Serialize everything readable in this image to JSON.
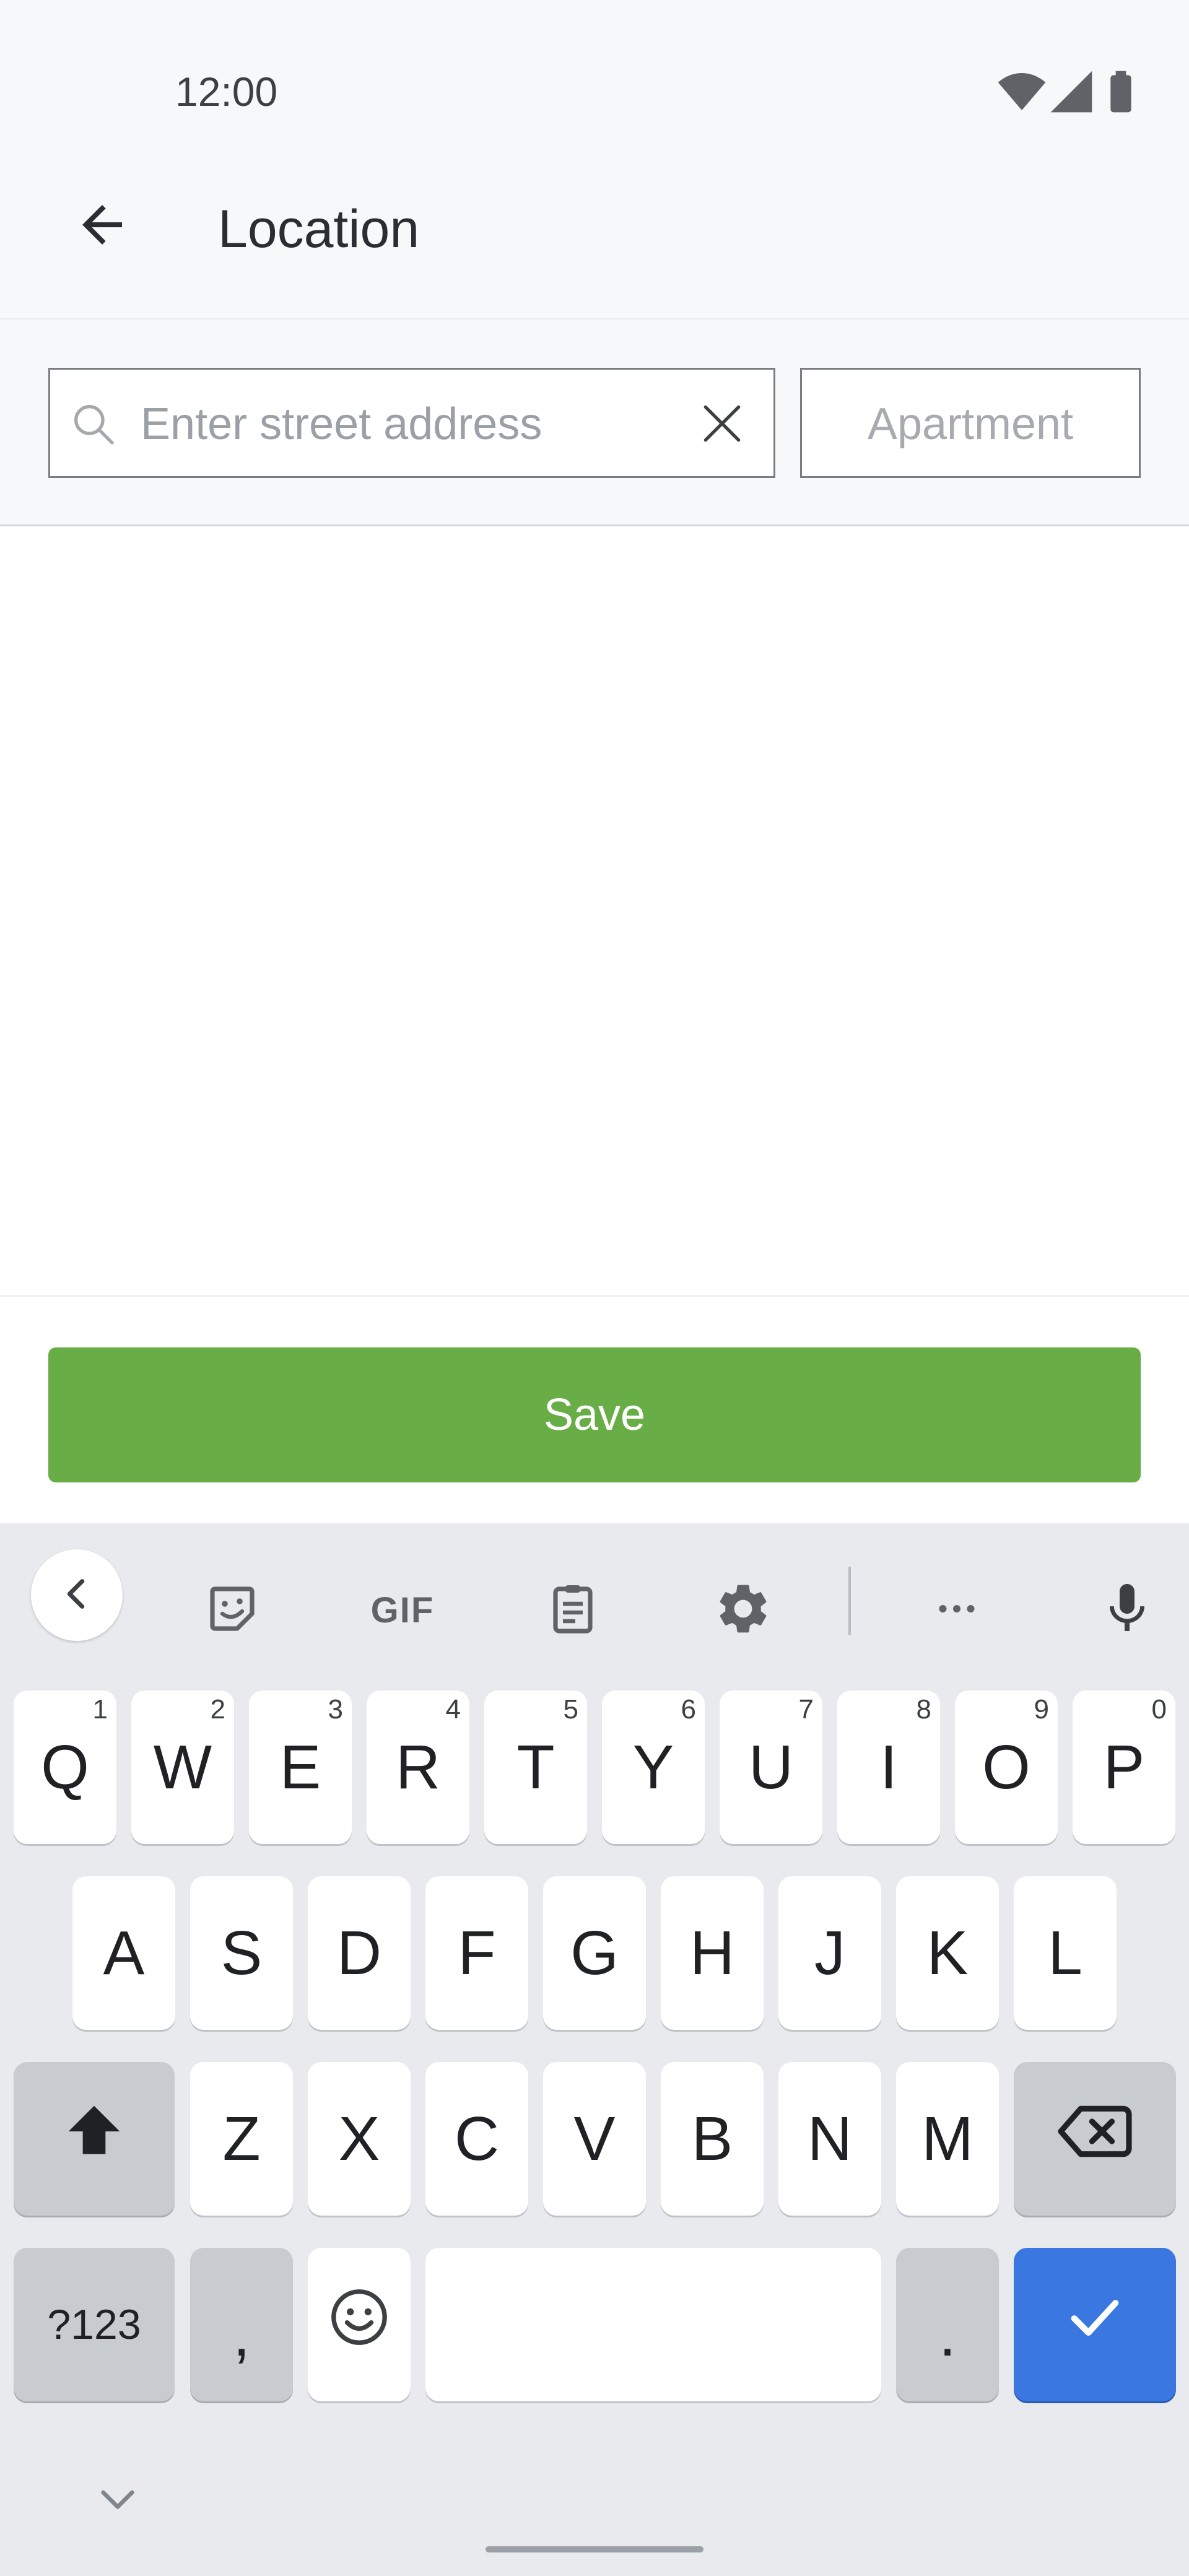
{
  "status_bar": {
    "time": "12:00",
    "icons": [
      "wifi-icon",
      "signal-icon",
      "battery-icon"
    ]
  },
  "app_bar": {
    "back_icon": "arrow-left-icon",
    "title": "Location"
  },
  "search": {
    "address_placeholder": "Enter street address",
    "address_value": "",
    "search_icon": "search-icon",
    "clear_icon": "close-icon",
    "apartment_placeholder": "Apartment",
    "apartment_value": ""
  },
  "save_button": {
    "label": "Save"
  },
  "keyboard": {
    "toolbar": {
      "collapse_icon": "chevron-left-icon",
      "sticker_icon": "sticker-icon",
      "gif_label": "GIF",
      "clipboard_icon": "clipboard-icon",
      "settings_icon": "gear-icon",
      "more_icon": "more-horizontal-icon",
      "mic_icon": "microphone-icon"
    },
    "row1": [
      {
        "label": "Q",
        "hint": "1"
      },
      {
        "label": "W",
        "hint": "2"
      },
      {
        "label": "E",
        "hint": "3"
      },
      {
        "label": "R",
        "hint": "4"
      },
      {
        "label": "T",
        "hint": "5"
      },
      {
        "label": "Y",
        "hint": "6"
      },
      {
        "label": "U",
        "hint": "7"
      },
      {
        "label": "I",
        "hint": "8"
      },
      {
        "label": "O",
        "hint": "9"
      },
      {
        "label": "P",
        "hint": "0"
      }
    ],
    "row2": [
      "A",
      "S",
      "D",
      "F",
      "G",
      "H",
      "J",
      "K",
      "L"
    ],
    "row3": [
      "Z",
      "X",
      "C",
      "V",
      "B",
      "N",
      "M"
    ],
    "shift_icon": "shift-icon",
    "backspace_icon": "backspace-icon",
    "symbols_label": "?123",
    "comma_label": ",",
    "emoji_icon": "emoji-icon",
    "period_label": ".",
    "enter_icon": "checkmark-icon",
    "nav_icon": "chevron-down-icon",
    "colors": {
      "key": "#ffffff",
      "dark_key": "#c8cbd0",
      "action_key": "#3b77e0"
    }
  },
  "colors": {
    "save_green": "#68ad46",
    "header_bg": "#f7f8fa"
  }
}
